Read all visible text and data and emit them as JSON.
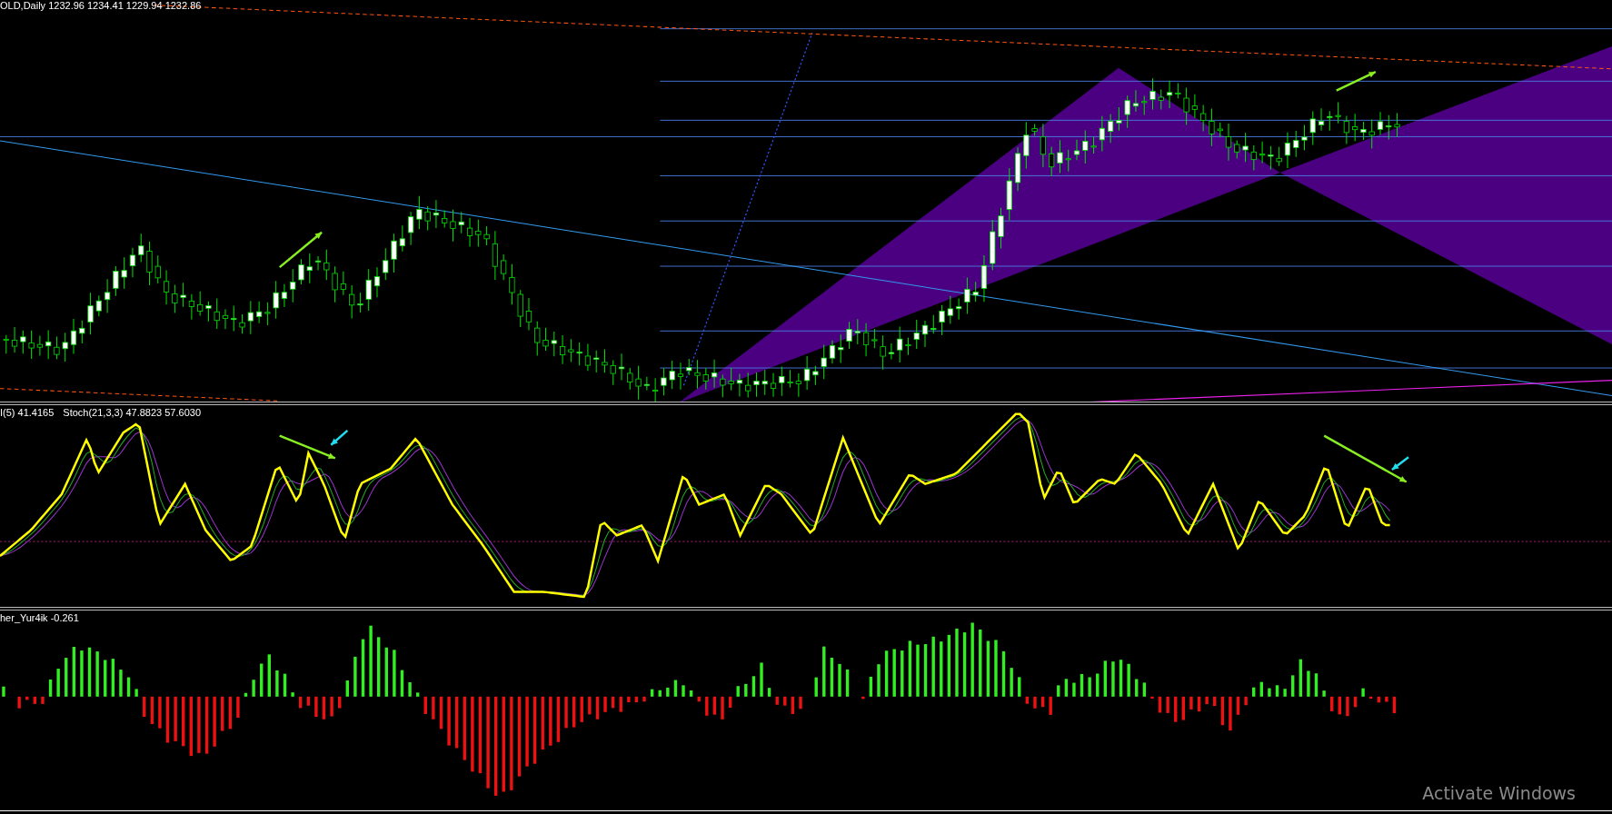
{
  "main_chart": {
    "label": "OLD,Daily 1232.96 1234.41 1229.94 1232.86"
  },
  "oscillator_panel": {
    "labels": [
      "I(5) 41.4165",
      "Stoch(21,3,3) 47.8823 57.6030"
    ]
  },
  "histogram_panel": {
    "label": "her_Yur4ik -0.261"
  },
  "os_notice": {
    "text": "Activate Windows"
  }
}
